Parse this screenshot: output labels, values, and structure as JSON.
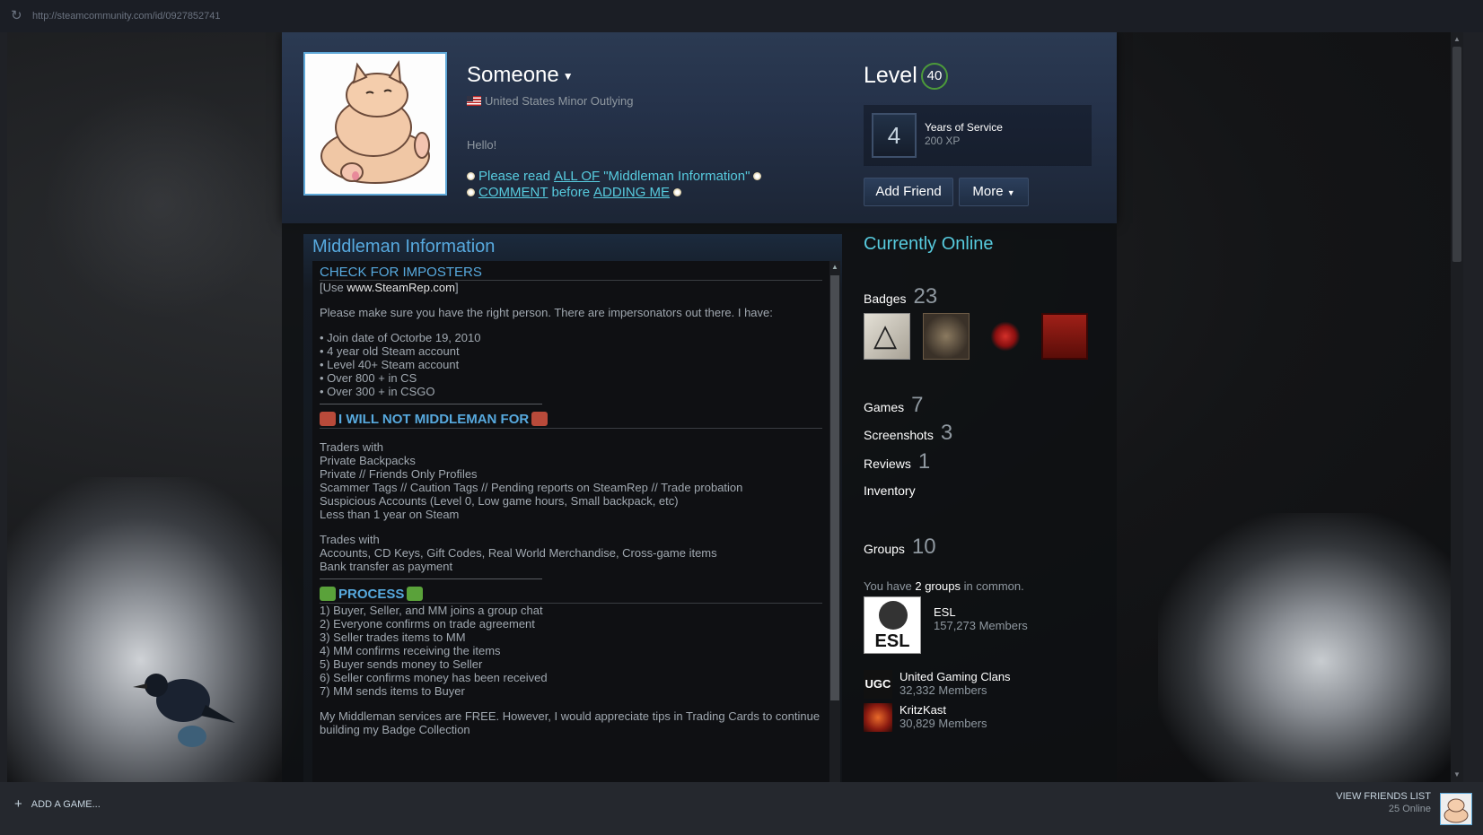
{
  "browser": {
    "url": "http://steamcommunity.com/id/0927852741"
  },
  "profile": {
    "persona_name": "Someone",
    "location": "United States Minor Outlying",
    "summary": "Hello!",
    "info_line1": {
      "prefix": "Please read ",
      "link": "ALL OF",
      "suffix": " \"Middleman Information\""
    },
    "info_line2": {
      "link1": "COMMENT",
      "mid": " before ",
      "link2": "ADDING ME"
    },
    "level_label": "Level",
    "level": "40",
    "favorite_badge": {
      "icon_text": "4",
      "name": "Years of Service",
      "xp": "200 XP"
    },
    "buttons": {
      "add_friend": "Add Friend",
      "more": "More"
    }
  },
  "showcase": {
    "title": "Middleman Information",
    "check_heading": "CHECK FOR IMPOSTERS",
    "use_prefix": "[Use ",
    "use_link": "www.SteamRep.com",
    "use_suffix": "]",
    "impersonators": "Please make sure you have the right person. There are impersonators out there. I have:",
    "have_list": [
      "• Join date of Octorbe 19, 2010",
      "• 4 year old Steam account",
      "• Level 40+ Steam account",
      "• Over 800 + in CS",
      "• Over 300 + in CSGO"
    ],
    "not_heading": "I WILL NOT MIDDLEMAN FOR",
    "traders_list": [
      "Traders with",
      "Private Backpacks",
      "Private // Friends Only Profiles",
      "Scammer Tags // Caution Tags // Pending reports on SteamRep // Trade probation",
      "Suspicious Accounts (Level 0, Low game hours, Small backpack, etc)",
      "Less than 1 year on Steam"
    ],
    "trades_list": [
      "Trades with",
      "Accounts, CD Keys, Gift Codes, Real World Merchandise, Cross-game items",
      "Bank transfer as payment"
    ],
    "process_heading": "PROCESS",
    "process_list": [
      "1) Buyer, Seller, and MM joins a group chat",
      "2) Everyone confirms on trade agreement",
      "3) Seller trades items to MM",
      "4) MM confirms receiving the items",
      "5) Buyer sends money to Seller",
      "6) Seller confirms money has been received",
      "7) MM sends items to Buyer"
    ],
    "footer_line1": "My Middleman services are FREE. However, I would appreciate tips in Trading Cards to continue",
    "footer_line2": "building my Badge Collection"
  },
  "sidebar": {
    "status": "Currently Online",
    "badges": {
      "label": "Badges",
      "count": "23"
    },
    "games": {
      "label": "Games",
      "count": "7"
    },
    "screenshots": {
      "label": "Screenshots",
      "count": "3"
    },
    "reviews": {
      "label": "Reviews",
      "count": "1"
    },
    "inventory": "Inventory",
    "groups": {
      "label": "Groups",
      "count": "10"
    },
    "common": {
      "prefix": "You have ",
      "bold": "2 groups",
      "suffix": " in common."
    },
    "group_list": [
      {
        "name": "ESL",
        "members": "157,273 Members",
        "avatar_text": "ESL"
      },
      {
        "name": "United Gaming Clans",
        "members": "32,332 Members",
        "avatar_text": "UGC"
      },
      {
        "name": "KritzKast",
        "members": "30,829 Members",
        "avatar_text": ""
      }
    ]
  },
  "bottombar": {
    "add_game": "ADD A GAME...",
    "view_friends": "VIEW FRIENDS LIST",
    "online_count": "25 Online"
  },
  "colors": {
    "accent": "#57cbde",
    "link": "#57a9de",
    "level_ring": "#4c9a3a"
  },
  "icons": [
    "refresh-icon",
    "caret-down-icon",
    "flag-icon",
    "plus-icon",
    "thumbs-down-icon",
    "thumbs-up-icon"
  ]
}
